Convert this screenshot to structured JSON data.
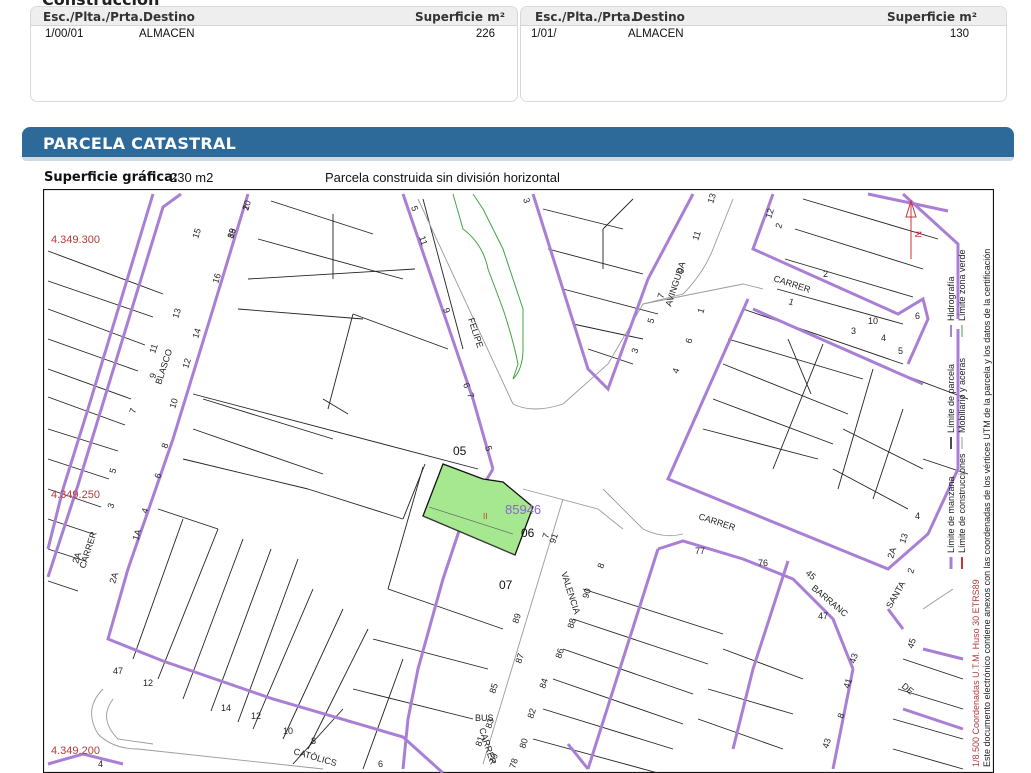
{
  "construccion": {
    "title": "Construcción",
    "headers": {
      "escalera": "Esc./Plta./Prta.",
      "destino": "Destino",
      "superficie": "Superficie m²"
    },
    "rows": [
      {
        "escalera": "1/00/01",
        "destino": "ALMACEN",
        "superficie": "226"
      },
      {
        "escalera": "1/01/",
        "destino": "ALMACEN",
        "superficie": "130"
      }
    ]
  },
  "parcela": {
    "title": "PARCELA CATASTRAL",
    "superficie_label": "Superficie gráfica:",
    "superficie_value": "230 m2",
    "descripcion": "Parcela construida sin división horizontal"
  },
  "map": {
    "colors": {
      "parcel_fill": "#a6e890",
      "block_line": "#a97fd6",
      "parcel_line": "#111111",
      "coord": "#b83a3a",
      "parcel_label": "#8a67c9",
      "green_line": "#3fa63f"
    },
    "coords": [
      "4.349.300",
      "4.349.250",
      "4.349.200"
    ],
    "parcel_ref": "85946",
    "sub_parcels": [
      "05",
      "06",
      "07"
    ],
    "streets": [
      "BLASCO",
      "FELIPE",
      "AVINGUDA",
      "CARRER",
      "CARRER",
      "CARRER",
      "VALENCIA",
      "BARRANC",
      "SANTA",
      "CATÒLICS",
      "CARRER",
      "DE",
      "BUS"
    ],
    "numbers": [
      "20",
      "18",
      "16",
      "15",
      "13",
      "14",
      "12",
      "11",
      "10",
      "9",
      "8",
      "7",
      "6",
      "5",
      "4",
      "3",
      "2A",
      "1A",
      "2A",
      "6",
      "5",
      "11",
      "9",
      "7",
      "5",
      "3",
      "13",
      "11",
      "9",
      "7",
      "5",
      "3",
      "1",
      "6",
      "4",
      "2",
      "12",
      "10",
      "1",
      "2",
      "3",
      "4",
      "5",
      "6",
      "7",
      "8",
      "91",
      "90",
      "89",
      "88",
      "87",
      "86",
      "85",
      "84",
      "83",
      "82",
      "81",
      "80",
      "79",
      "78",
      "77",
      "76",
      "47",
      "45",
      "43",
      "8",
      "41",
      "43",
      "45",
      "47",
      "12",
      "14",
      "12",
      "10",
      "8",
      "6",
      "4",
      "2A",
      "13",
      "4",
      "2",
      "1",
      "89"
    ],
    "legend": {
      "items": [
        "Límite de manzana",
        "Límite de construcciones",
        "Límite de parcela",
        "Mobiliario y aceras",
        "Hidrografía",
        "Límite zona verde"
      ],
      "coord_note": "1/8.500 Coordenadas U.T.M. Huso 30 ETRS89",
      "doc_note": "Este documento electrónico contiene anexos con las coordenadas de los vértices UTM de la parcela y los datos de la certificación"
    }
  }
}
